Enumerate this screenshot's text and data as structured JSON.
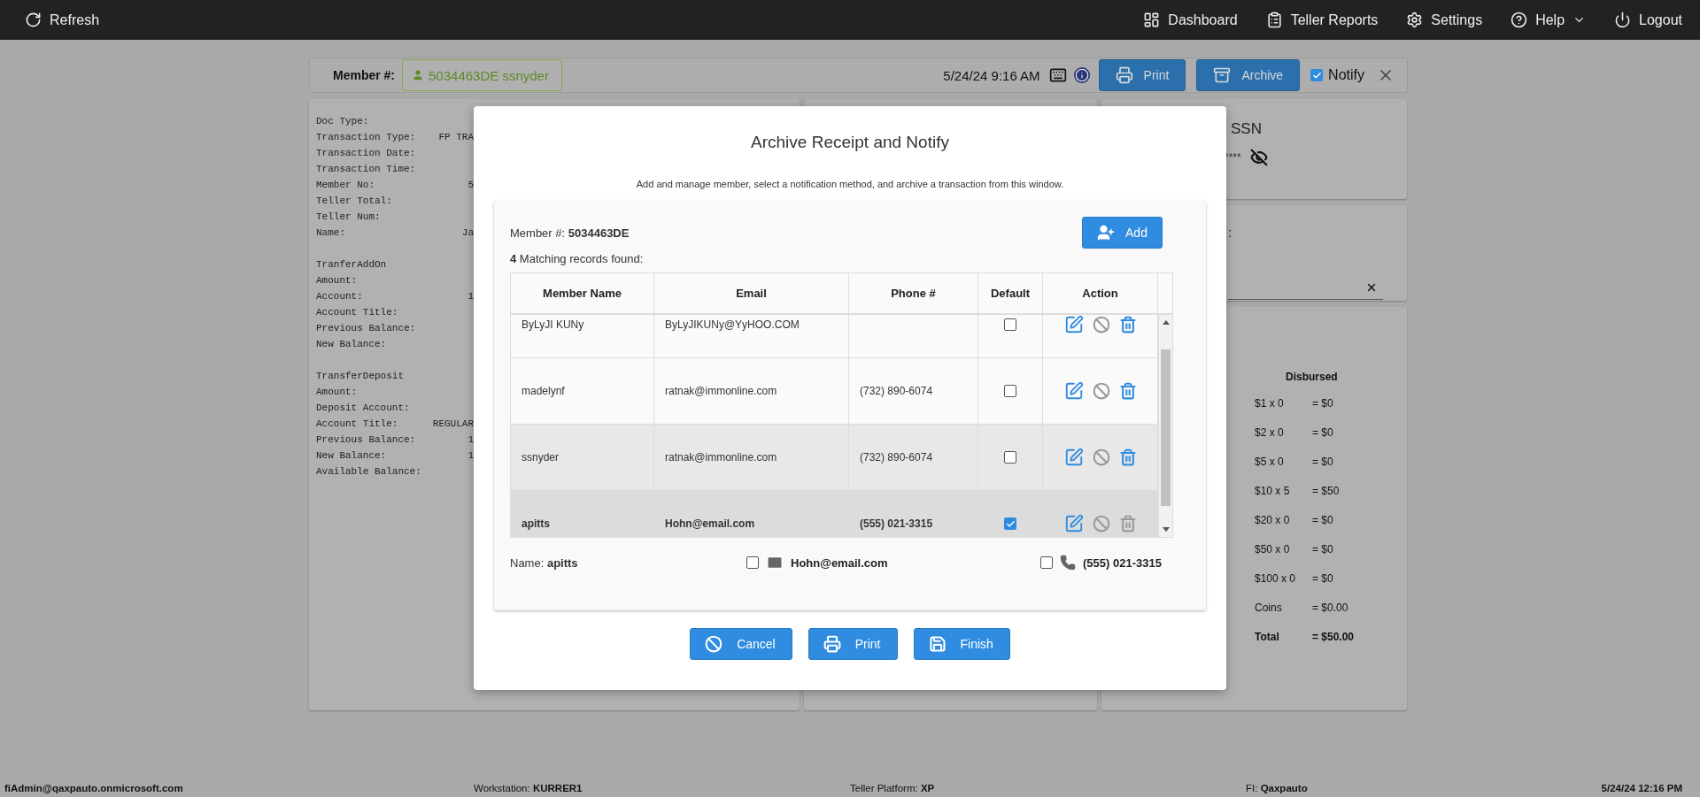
{
  "nav": {
    "left": [
      {
        "kind": "refresh",
        "label": "Refresh"
      }
    ],
    "right": [
      {
        "kind": "dashboard",
        "label": "Dashboard"
      },
      {
        "kind": "reports",
        "label": "Teller Reports"
      },
      {
        "kind": "settings",
        "label": "Settings"
      },
      {
        "kind": "help",
        "label": "Help"
      },
      {
        "kind": "logout",
        "label": "Logout"
      }
    ]
  },
  "header": {
    "member_label": "Member #:",
    "member_chip": "5034463DE ssnyder",
    "datetime": "5/24/24 9:16 AM",
    "buttons": [
      {
        "kind": "print",
        "label": "Print"
      },
      {
        "kind": "archive",
        "label": "Archive"
      }
    ],
    "notify": {
      "label": "Notify",
      "checked": true
    }
  },
  "receipt": {
    "sections": [
      {
        "lines": [
          {
            "label": "Doc Type:"
          },
          {
            "label": "Transaction Type:",
            "value": "FP TRA"
          },
          {
            "label": "Transaction Date:"
          },
          {
            "label": "Transaction Time:"
          },
          {
            "label": "Member No:",
            "value": "5"
          },
          {
            "label": "Teller Total:"
          },
          {
            "label": "Teller Num:"
          },
          {
            "label": "Name:",
            "value": "Ja"
          }
        ]
      },
      {
        "lines": [
          {
            "label": "TranferAddOn"
          },
          {
            "label": "Amount:"
          },
          {
            "label": "Account:",
            "value": "1"
          },
          {
            "label": "Account Title:"
          },
          {
            "label": "Previous Balance:"
          },
          {
            "label": "New Balance:"
          }
        ]
      },
      {
        "lines": [
          {
            "label": "TransferDeposit"
          },
          {
            "label": "Amount:"
          },
          {
            "label": "Deposit Account:"
          },
          {
            "label": "Account Title:",
            "value": "REGULAR"
          },
          {
            "label": "Previous Balance:",
            "value": "1"
          },
          {
            "label": "New Balance:",
            "value": "1"
          },
          {
            "label": "Available Balance:"
          }
        ]
      }
    ]
  },
  "ssn_panel": {
    "label": "SSN",
    "masked": "****"
  },
  "field_panel": {
    "label": ":"
  },
  "cash_panel": {
    "heading": "Disbursed",
    "rows": [
      {
        "kind": "row",
        "label": "$1 x 0",
        "value": "= $0"
      },
      {
        "kind": "row",
        "label": "$2 x 0",
        "value": "= $0"
      },
      {
        "kind": "row",
        "label": "$5 x 0",
        "value": "= $0"
      },
      {
        "kind": "row",
        "label": "$10 x 5",
        "value": "= $50"
      },
      {
        "kind": "row",
        "label": "$20 x 0",
        "value": "= $0"
      },
      {
        "kind": "row",
        "label": "$50 x 0",
        "value": "= $0"
      },
      {
        "kind": "row",
        "label": "$100 x 0",
        "value": "= $0"
      },
      {
        "kind": "row",
        "label": "Coins",
        "value": "= $0.00"
      },
      {
        "kind": "total",
        "label": "Total",
        "value": "= $50.00"
      }
    ]
  },
  "modal": {
    "title": "Archive Receipt and Notify",
    "subtitle": "Add and manage member, select a notification method, and archive a transaction from this window.",
    "member": "Member #: **5034463DE**",
    "add_button": "Add",
    "matches": "**4** Matching records found:",
    "columns": [
      "Member Name",
      "Email",
      "Phone #",
      "Default",
      "Action"
    ],
    "rows": [
      {
        "name": "ByLyJI KUNy",
        "email": "ByLyJIKUNy@YyHOO.COM",
        "default": false,
        "selected": false,
        "hovered": false,
        "delete_disabled": false
      },
      {
        "name": "madelynf",
        "email": "ratnak@immonline.com",
        "phone": "(732) 890-6074",
        "default": false,
        "selected": false,
        "hovered": false,
        "delete_disabled": false
      },
      {
        "name": "ssnyder",
        "email": "ratnak@immonline.com",
        "phone": "(732) 890-6074",
        "default": false,
        "selected": false,
        "hovered": true,
        "delete_disabled": false
      },
      {
        "name": "apitts",
        "email": "Hohn@email.com",
        "phone": "(555) 021-3315",
        "default": true,
        "selected": true,
        "hovered": false,
        "delete_disabled": true
      }
    ],
    "contact": {
      "name": "Name: **apitts**",
      "email": {
        "value": "Hohn@email.com",
        "checked": false
      },
      "phone": {
        "value": "(555) 021-3315",
        "checked": false
      }
    },
    "buttons": [
      {
        "kind": "cancel",
        "label": "Cancel"
      },
      {
        "kind": "print",
        "label": "Print"
      },
      {
        "kind": "finish",
        "label": "Finish"
      }
    ]
  },
  "status_bar": [
    {
      "text": "**fiAdmin@qaxpauto.onmicrosoft.com**"
    },
    {
      "text": "Workstation: **KURRER1**"
    },
    {
      "text": "Teller Platform: **XP**"
    },
    {
      "text": "FI: **Qaxpauto**"
    },
    {
      "text": "**5/24/24 12:16 PM**"
    }
  ]
}
